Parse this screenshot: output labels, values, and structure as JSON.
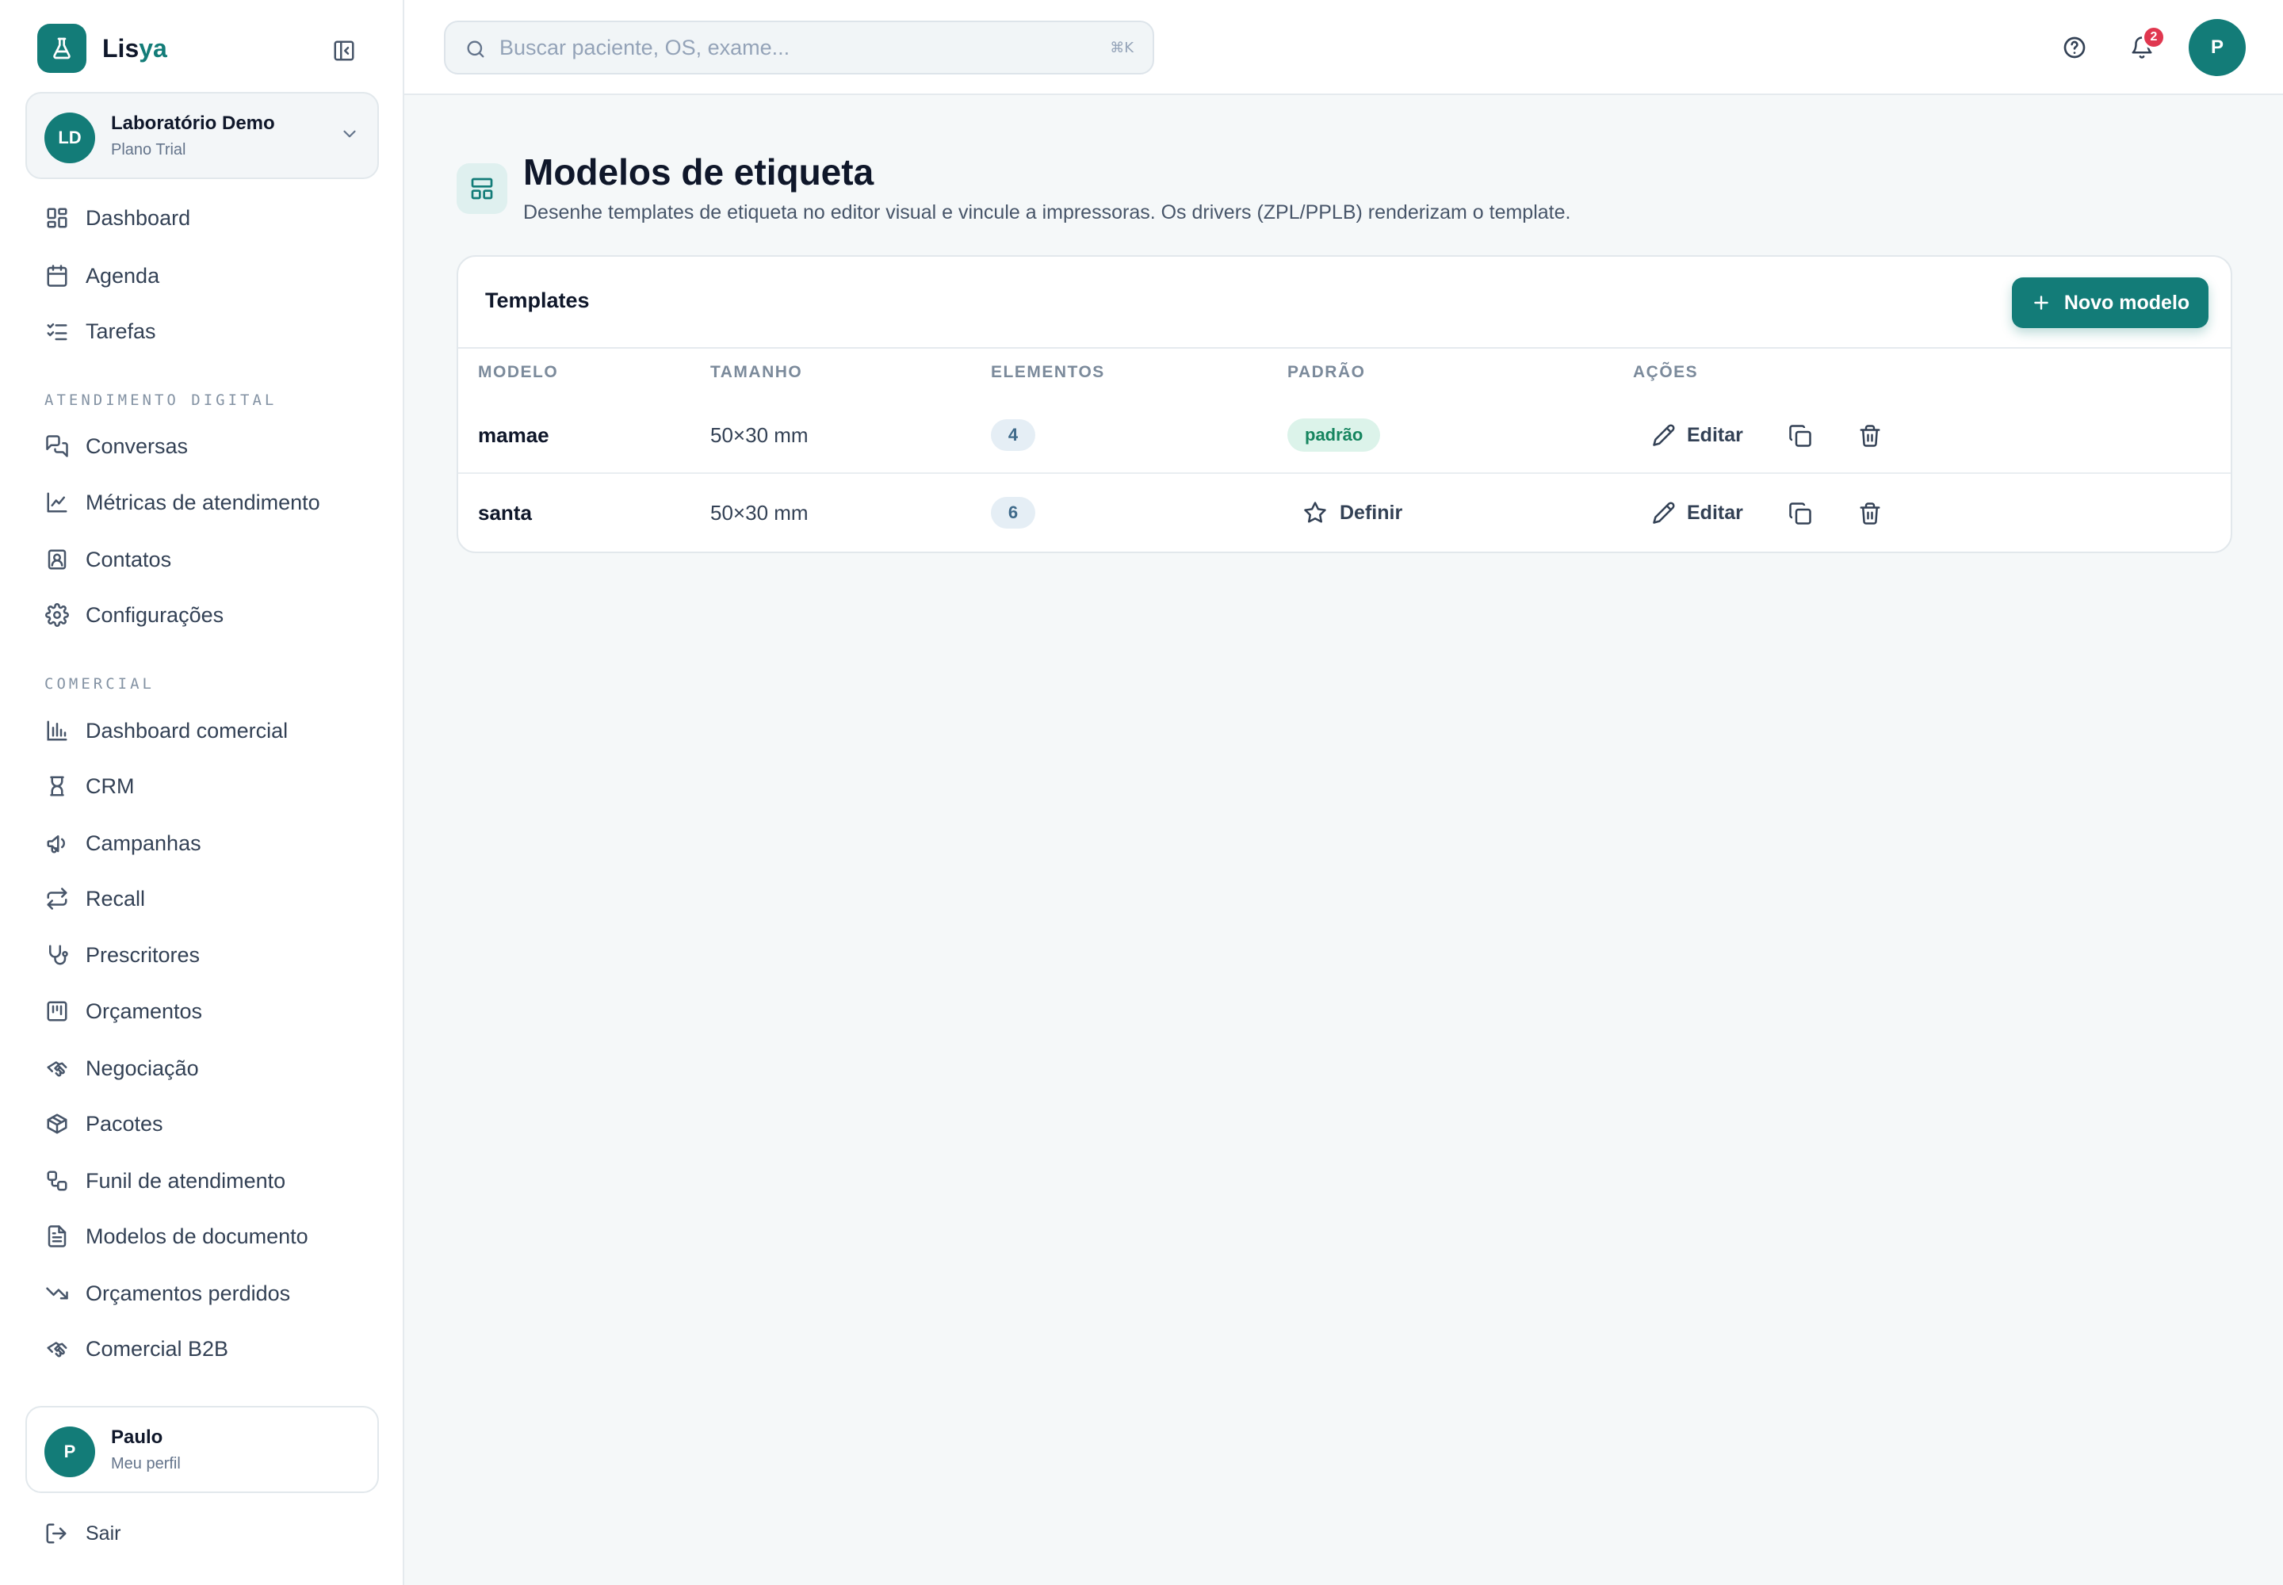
{
  "brand": {
    "name_a": "Lis",
    "name_b": "ya"
  },
  "org": {
    "initials": "LD",
    "name": "Laboratório Demo",
    "plan": "Plano Trial"
  },
  "nav": {
    "top": [
      {
        "label": "Dashboard",
        "icon": "dashboard-grid-icon"
      },
      {
        "label": "Agenda",
        "icon": "calendar-icon"
      },
      {
        "label": "Tarefas",
        "icon": "checklist-icon"
      }
    ],
    "section_digital": "ATENDIMENTO DIGITAL",
    "digital": [
      {
        "label": "Conversas",
        "icon": "chat-bubbles-icon"
      },
      {
        "label": "Métricas de atendimento",
        "icon": "line-chart-icon"
      },
      {
        "label": "Contatos",
        "icon": "contact-card-icon"
      },
      {
        "label": "Configurações",
        "icon": "gear-icon"
      }
    ],
    "section_comercial": "COMERCIAL",
    "comercial": [
      {
        "label": "Dashboard comercial",
        "icon": "bar-chart-icon"
      },
      {
        "label": "CRM",
        "icon": "crm-icon"
      },
      {
        "label": "Campanhas",
        "icon": "megaphone-icon"
      },
      {
        "label": "Recall",
        "icon": "repeat-arrows-icon"
      },
      {
        "label": "Prescritores",
        "icon": "stethoscope-icon"
      },
      {
        "label": "Orçamentos",
        "icon": "receipt-icon"
      },
      {
        "label": "Negociação",
        "icon": "handshake-icon"
      },
      {
        "label": "Pacotes",
        "icon": "package-icon"
      },
      {
        "label": "Funil de atendimento",
        "icon": "workflow-icon"
      },
      {
        "label": "Modelos de documento",
        "icon": "document-icon"
      },
      {
        "label": "Orçamentos perdidos",
        "icon": "trending-down-icon"
      },
      {
        "label": "Comercial B2B",
        "icon": "handshake-icon"
      }
    ]
  },
  "profile": {
    "initial": "P",
    "name": "Paulo",
    "sub": "Meu perfil"
  },
  "logout": {
    "label": "Sair"
  },
  "search": {
    "placeholder": "Buscar paciente, OS, exame...",
    "shortcut": "⌘K"
  },
  "topbar": {
    "notifications_count": "2",
    "user_initial": "P"
  },
  "page": {
    "title": "Modelos de etiqueta",
    "subtitle": "Desenhe templates de etiqueta no editor visual e vincule a impressoras. Os drivers (ZPL/PPLB) renderizam o template."
  },
  "card": {
    "title": "Templates",
    "new_button": "Novo modelo",
    "columns": [
      "MODELO",
      "TAMANHO",
      "ELEMENTOS",
      "PADRÃO",
      "AÇÕES"
    ],
    "rows": [
      {
        "name": "mamae",
        "size": "50×30 mm",
        "elements": "4",
        "default_label": "padrão",
        "is_default": true,
        "edit": "Editar"
      },
      {
        "name": "santa",
        "size": "50×30 mm",
        "elements": "6",
        "define_label": "Definir",
        "is_default": false,
        "edit": "Editar"
      }
    ]
  },
  "colors": {
    "accent": "#137c78",
    "badge": "#e0374f",
    "default_pill_bg": "#dcf3ea",
    "default_pill_text": "#16855f"
  }
}
